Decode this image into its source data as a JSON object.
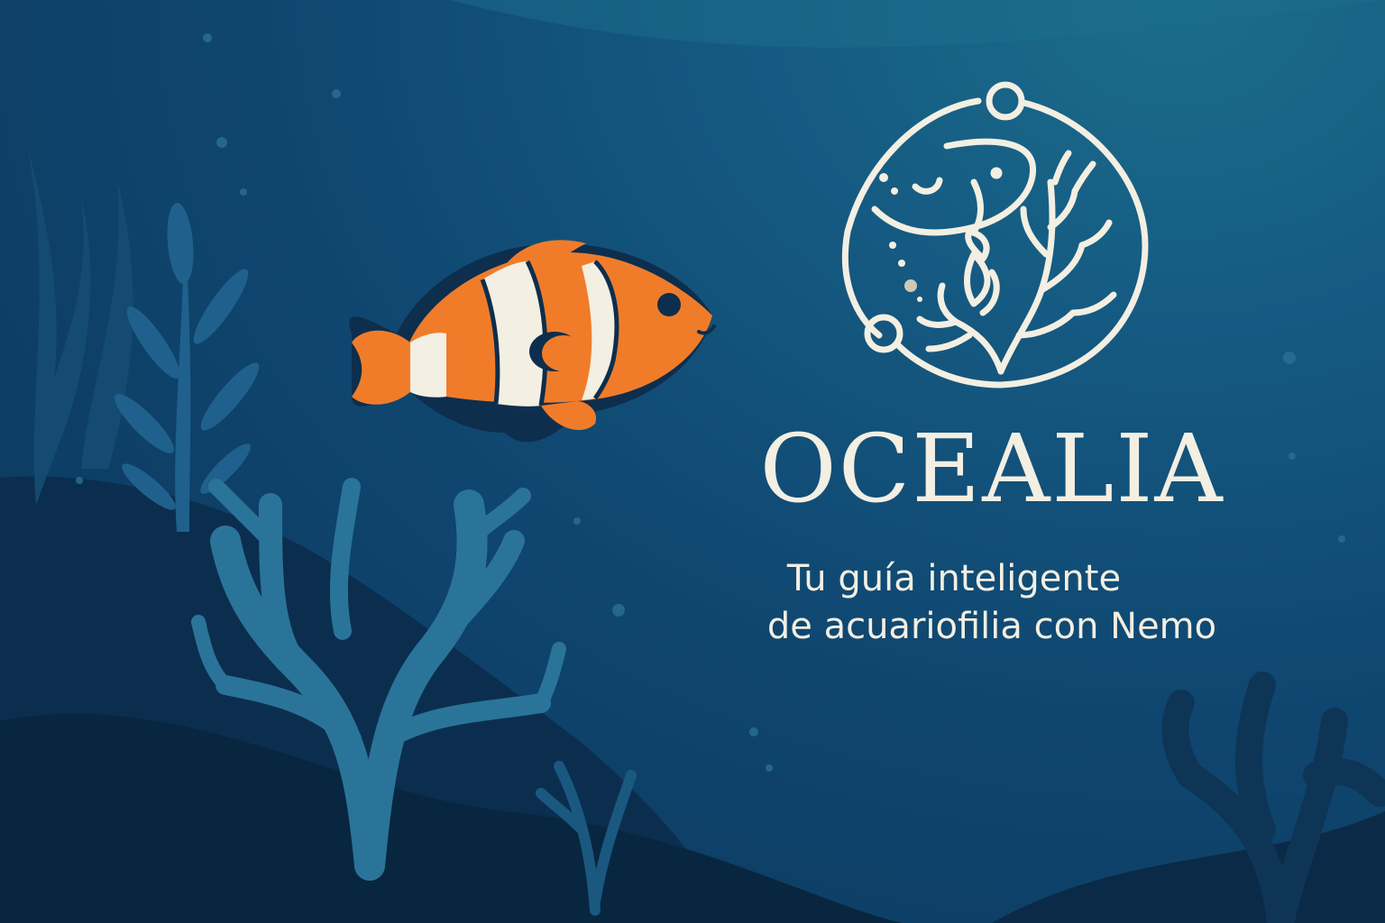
{
  "brand": {
    "name": "OCEALIA",
    "tagline_line1": "Tu guía inteligente",
    "tagline_line2": "de acuariofilia con Nemo"
  },
  "icons": {
    "emblem": "circle-coral-fish-logo-icon",
    "mascot": "clownfish-icon"
  },
  "colors": {
    "background": "#0f4670",
    "cream": "#f3efe2",
    "clownfish_orange": "#f07c2a",
    "seaweed": "#2b7499"
  }
}
